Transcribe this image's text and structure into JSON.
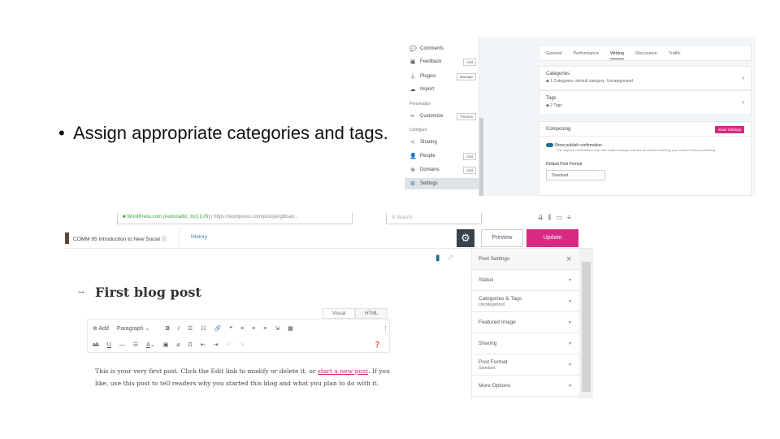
{
  "slide": {
    "bullet": "Assign appropriate categories and tags."
  },
  "settings_screen": {
    "sidebar": {
      "items": [
        {
          "icon": "comments-icon",
          "glyph": "💬",
          "label": "Comments",
          "badge": ""
        },
        {
          "icon": "feedback-icon",
          "glyph": "▣",
          "label": "Feedback",
          "badge": "Add"
        },
        {
          "icon": "plugins-icon",
          "glyph": "⏚",
          "label": "Plugins",
          "badge": "Manage"
        },
        {
          "icon": "import-icon",
          "glyph": "☁",
          "label": "Import",
          "badge": ""
        },
        {
          "icon": "customize-icon",
          "glyph": "✂",
          "label": "Customize",
          "badge": "Themes"
        },
        {
          "icon": "sharing-icon",
          "glyph": "<",
          "label": "Sharing",
          "badge": ""
        },
        {
          "icon": "people-icon",
          "glyph": "👤",
          "label": "People",
          "badge": "Add"
        },
        {
          "icon": "domains-icon",
          "glyph": "⊕",
          "label": "Domains",
          "badge": "Add"
        },
        {
          "icon": "settings-icon",
          "glyph": "⚙",
          "label": "Settings",
          "badge": ""
        }
      ],
      "section_personalize": "Personalize",
      "section_configure": "Configure"
    },
    "tabs": [
      "General",
      "Performance",
      "Writing",
      "Discussion",
      "Traffic"
    ],
    "active_tab": "Writing",
    "categories": {
      "title": "Categories",
      "detail": "1 Categories, default category: Uncategorized"
    },
    "tags": {
      "title": "Tags",
      "detail": "2 Tags"
    },
    "composing": {
      "title": "Composing",
      "save_button": "Save Settings",
      "toggle_label": "Show publish confirmation",
      "toggle_desc": "The Jetpack confirmation step with helpful settings and tips for double-checking your content before publishing.",
      "default_format_label": "Default Post Format",
      "default_format_value": "Standard"
    },
    "accent": "#d52c82"
  },
  "editor_screen": {
    "browser": {
      "secure_label": "WordPress.com (Automattic, Inc) (US)",
      "url": "https://wordpress.com/post/jengibsan...",
      "search_placeholder": "Search"
    },
    "header": {
      "site": "COMM 95 Introduction to New Social",
      "history": "History",
      "preview": "Preview",
      "update": "Update"
    },
    "post_title": "First blog post",
    "mode_tabs": [
      "Visual",
      "HTML"
    ],
    "toolbar": {
      "add": "Add",
      "format": "Paragraph"
    },
    "body_before": "This is your very first post. Click the Edit link to modify or delete it, or ",
    "body_link": "start a new post",
    "body_after": ". If you like, use this post to tell readers why you started this blog and what you plan to do with it.",
    "panel": {
      "title": "Post Settings",
      "rows": [
        {
          "label": "Status",
          "sub": ""
        },
        {
          "label": "Categories & Tags",
          "sub": "Uncategorized"
        },
        {
          "label": "Featured Image",
          "sub": ""
        },
        {
          "label": "Sharing",
          "sub": ""
        },
        {
          "label": "Post Format",
          "sub": "Standard"
        },
        {
          "label": "More Options",
          "sub": ""
        }
      ]
    }
  }
}
